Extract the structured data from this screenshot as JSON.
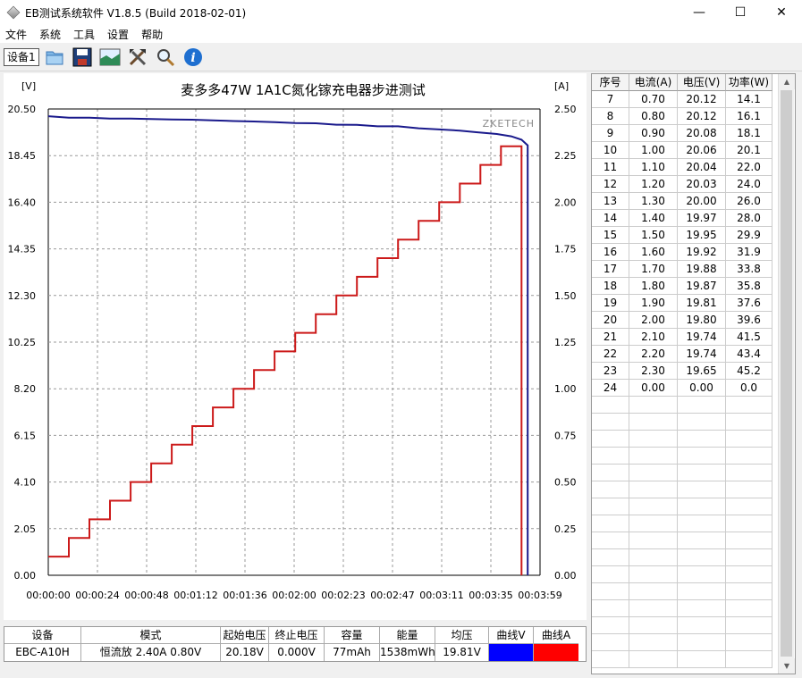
{
  "window": {
    "title": "EB测试系统软件 V1.8.5 (Build 2018-02-01)",
    "minimize": "—",
    "maximize": "☐",
    "close": "✕"
  },
  "menu": [
    "文件",
    "系统",
    "工具",
    "设置",
    "帮助"
  ],
  "toolbar": {
    "device_tab": "设备1",
    "icons": [
      "folder-icon",
      "save-icon",
      "chart-image-icon",
      "tools-icon",
      "search-icon",
      "info-icon"
    ]
  },
  "chart_data": {
    "type": "line",
    "title": "麦多多47W 1A1C氮化镓充电器步进测试",
    "watermark": "ZKETECH",
    "ylabel_left": "[V]",
    "ylabel_right": "[A]",
    "left_ticks": [
      "20.50",
      "18.45",
      "16.40",
      "14.35",
      "12.30",
      "10.25",
      "8.20",
      "6.15",
      "4.10",
      "2.05",
      "0.00"
    ],
    "right_ticks": [
      "2.50",
      "2.25",
      "2.00",
      "1.75",
      "1.50",
      "1.25",
      "1.00",
      "0.75",
      "0.50",
      "0.25",
      "0.00"
    ],
    "x_ticks": [
      "00:00:00",
      "00:00:24",
      "00:00:48",
      "00:01:12",
      "00:01:36",
      "00:02:00",
      "00:02:23",
      "00:02:47",
      "00:03:11",
      "00:03:35",
      "00:03:59"
    ],
    "ylim_left": [
      0,
      20.5
    ],
    "ylim_right": [
      0,
      2.5
    ],
    "xlim_seconds": [
      0,
      239
    ],
    "grid": true,
    "series": [
      {
        "name": "曲线V",
        "color": "#1a1a8c",
        "axis": "left",
        "points": [
          [
            0,
            20.18
          ],
          [
            10,
            20.12
          ],
          [
            20,
            20.12
          ],
          [
            30,
            20.08
          ],
          [
            40,
            20.08
          ],
          [
            50,
            20.06
          ],
          [
            60,
            20.04
          ],
          [
            70,
            20.03
          ],
          [
            80,
            20.0
          ],
          [
            90,
            19.97
          ],
          [
            100,
            19.95
          ],
          [
            110,
            19.92
          ],
          [
            120,
            19.88
          ],
          [
            130,
            19.87
          ],
          [
            140,
            19.81
          ],
          [
            150,
            19.8
          ],
          [
            160,
            19.74
          ],
          [
            170,
            19.74
          ],
          [
            180,
            19.65
          ],
          [
            190,
            19.6
          ],
          [
            200,
            19.55
          ],
          [
            208,
            19.48
          ],
          [
            218,
            19.4
          ],
          [
            225,
            19.3
          ],
          [
            230,
            19.15
          ],
          [
            233,
            18.9
          ]
        ]
      },
      {
        "name": "曲线A",
        "color": "#cc1a1a",
        "axis": "right",
        "steps": [
          0.1,
          0.2,
          0.3,
          0.4,
          0.5,
          0.6,
          0.7,
          0.8,
          0.9,
          1.0,
          1.1,
          1.2,
          1.3,
          1.4,
          1.5,
          1.6,
          1.7,
          1.8,
          1.9,
          2.0,
          2.1,
          2.2,
          2.3,
          0.0
        ],
        "step_seconds": 10
      }
    ]
  },
  "table": {
    "headers": [
      "序号",
      "电流(A)",
      "电压(V)",
      "功率(W)"
    ],
    "rows": [
      [
        "7",
        "0.70",
        "20.12",
        "14.1"
      ],
      [
        "8",
        "0.80",
        "20.12",
        "16.1"
      ],
      [
        "9",
        "0.90",
        "20.08",
        "18.1"
      ],
      [
        "10",
        "1.00",
        "20.06",
        "20.1"
      ],
      [
        "11",
        "1.10",
        "20.04",
        "22.0"
      ],
      [
        "12",
        "1.20",
        "20.03",
        "24.0"
      ],
      [
        "13",
        "1.30",
        "20.00",
        "26.0"
      ],
      [
        "14",
        "1.40",
        "19.97",
        "28.0"
      ],
      [
        "15",
        "1.50",
        "19.95",
        "29.9"
      ],
      [
        "16",
        "1.60",
        "19.92",
        "31.9"
      ],
      [
        "17",
        "1.70",
        "19.88",
        "33.8"
      ],
      [
        "18",
        "1.80",
        "19.87",
        "35.8"
      ],
      [
        "19",
        "1.90",
        "19.81",
        "37.6"
      ],
      [
        "20",
        "2.00",
        "19.80",
        "39.6"
      ],
      [
        "21",
        "2.10",
        "19.74",
        "41.5"
      ],
      [
        "22",
        "2.20",
        "19.74",
        "43.4"
      ],
      [
        "23",
        "2.30",
        "19.65",
        "45.2"
      ],
      [
        "24",
        "0.00",
        "0.00",
        "0.0"
      ]
    ]
  },
  "summary": {
    "headers": [
      "设备",
      "模式",
      "起始电压",
      "终止电压",
      "容量",
      "能量",
      "均压",
      "曲线V",
      "曲线A"
    ],
    "device": "EBC-A10H",
    "mode": "恒流放 2.40A 0.80V",
    "start_voltage": "20.18V",
    "end_voltage": "0.000V",
    "capacity": "77mAh",
    "energy": "1538mWh",
    "avg_voltage": "19.81V",
    "curve_v_color": "#0000ff",
    "curve_a_color": "#ff0000"
  }
}
